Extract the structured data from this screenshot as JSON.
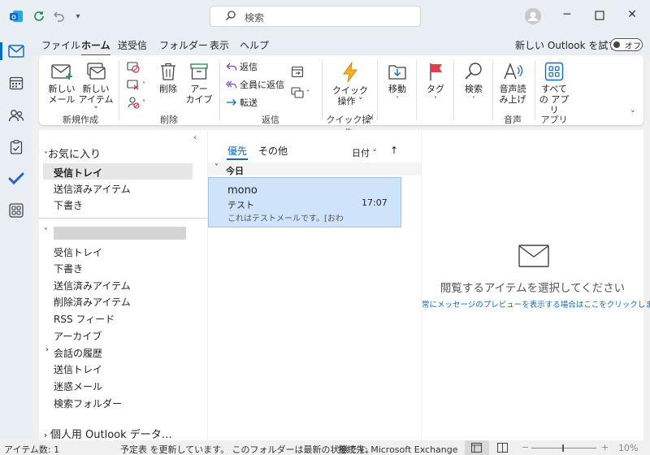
{
  "titlebar": {
    "search_placeholder": "検索"
  },
  "menu": {
    "tabs": [
      "ファイル",
      "ホーム",
      "送受信",
      "フォルダー",
      "表示",
      "ヘルプ"
    ],
    "active": "ホーム",
    "new_outlook_label": "新しい Outlook を試す",
    "toggle_label": "オフ"
  },
  "ribbon": {
    "new_mail": [
      "新しい",
      "メール"
    ],
    "new_item": [
      "新しい",
      "アイテム ˅"
    ],
    "group_new": "新規作成",
    "delete": "削除",
    "archive": [
      "アー",
      "カイブ"
    ],
    "group_delete": "削除",
    "reply": "返信",
    "reply_all": "全員に返信",
    "forward": "転送",
    "group_reply": "返信",
    "quick_steps": [
      "クイック",
      "操作 ˅"
    ],
    "group_quick": "クイック操作",
    "move": "移動",
    "tag": "タグ",
    "find": "検索",
    "read_aloud": [
      "音声読",
      "み上げ"
    ],
    "group_voice": "音声",
    "all_apps": [
      "すべて",
      "の アプリ"
    ],
    "group_apps": "アプリ"
  },
  "folders": {
    "favorites_header": "お気に入り",
    "favorites": [
      "受信トレイ",
      "送信済みアイテム",
      "下書き"
    ],
    "account_items": [
      "受信トレイ",
      "下書き",
      "送信済みアイテム",
      "削除済みアイテム",
      "RSS フィード",
      "アーカイブ",
      "会話の履歴",
      "送信トレイ",
      "迷惑メール",
      "検索フォルダー"
    ],
    "personal_header": "個人用 Outlook データ…"
  },
  "messages": {
    "tab_focused": "優先",
    "tab_other": "その他",
    "sort_label": "日付 ˅",
    "sort_arrow": "↑",
    "group_today": "今日",
    "items": [
      {
        "sender": "mono",
        "subject": "テスト",
        "time": "17:07",
        "preview": "これはテストメールです。[おわ"
      }
    ]
  },
  "reading": {
    "empty_title": "閲覧するアイテムを選択してください",
    "preview_link": "常にメッセージのプレビューを表示する場合はここをクリックします"
  },
  "status": {
    "item_count": "アイテム数: 1",
    "calendar": "予定表 を更新しています。 このフォルダーは最新の状態です。",
    "connection": "接続先: Microsoft Exchange",
    "zoom": "10%"
  },
  "colors": {
    "accent": "#0f6cbd",
    "selected_bg": "#cfe4fa",
    "favorite_selected": "#e6e6e6"
  }
}
